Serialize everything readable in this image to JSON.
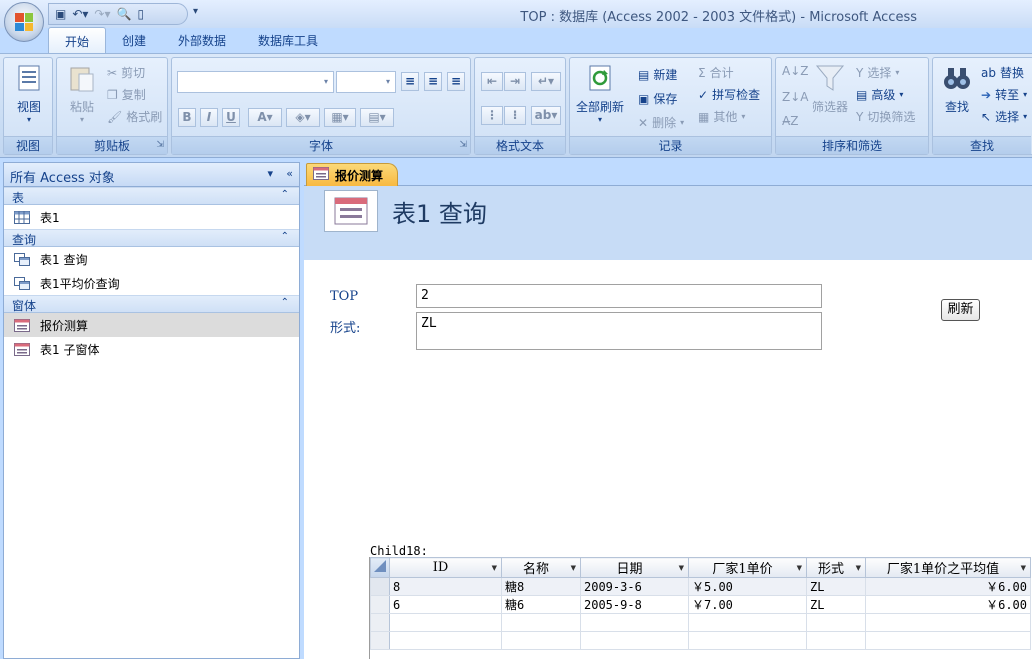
{
  "window": {
    "title": "TOP : 数据库 (Access 2002 - 2003 文件格式) - Microsoft Access"
  },
  "ribbon": {
    "tabs": [
      "开始",
      "创建",
      "外部数据",
      "数据库工具"
    ],
    "groups": {
      "views": {
        "label": "视图",
        "view_button": "视图"
      },
      "clipboard": {
        "label": "剪贴板",
        "paste": "粘贴",
        "cut": "剪切",
        "copy": "复制",
        "format_painter": "格式刷"
      },
      "font": {
        "label": "字体"
      },
      "rich_text": {
        "label": "格式文本"
      },
      "records": {
        "label": "记录",
        "refresh_all": "全部刷新",
        "new": "新建",
        "save": "保存",
        "delete": "删除",
        "totals": "合计",
        "spelling": "拼写检查",
        "more": "其他"
      },
      "sort_filter": {
        "label": "排序和筛选",
        "filter": "筛选器",
        "selection": "选择",
        "advanced": "高级",
        "toggle_filter": "切换筛选"
      },
      "find": {
        "label": "查找",
        "find": "查找",
        "replace": "替换",
        "goto": "转至",
        "select": "选择"
      }
    }
  },
  "nav": {
    "header": "所有 Access 对象",
    "sections": [
      {
        "name": "表",
        "items": [
          "表1"
        ]
      },
      {
        "name": "查询",
        "items": [
          "表1 查询",
          "表1平均价查询"
        ]
      },
      {
        "name": "窗体",
        "items": [
          "报价测算",
          "表1 子窗体"
        ]
      }
    ]
  },
  "document": {
    "tab_label": "报价测算",
    "form_title": "表1 查询",
    "fields": {
      "top_label": "TOP",
      "top_value": "2",
      "form_label": "形式:",
      "form_value": "ZL"
    },
    "refresh_button": "刷新",
    "subform": {
      "label": "Child18:",
      "columns": [
        "ID",
        "名称",
        "日期",
        "厂家1单价",
        "形式",
        "厂家1单价之平均值"
      ],
      "rows": [
        [
          "8",
          "糖8",
          "2009-3-6",
          "￥5.00",
          "ZL",
          "￥6.00"
        ],
        [
          "6",
          "糖6",
          "2005-9-8",
          "￥7.00",
          "ZL",
          "￥6.00"
        ]
      ]
    }
  },
  "colors": {
    "ribbon_bg": "#c7dbf3",
    "accent_tab": "#f8b941",
    "text_blue": "#15428b"
  }
}
